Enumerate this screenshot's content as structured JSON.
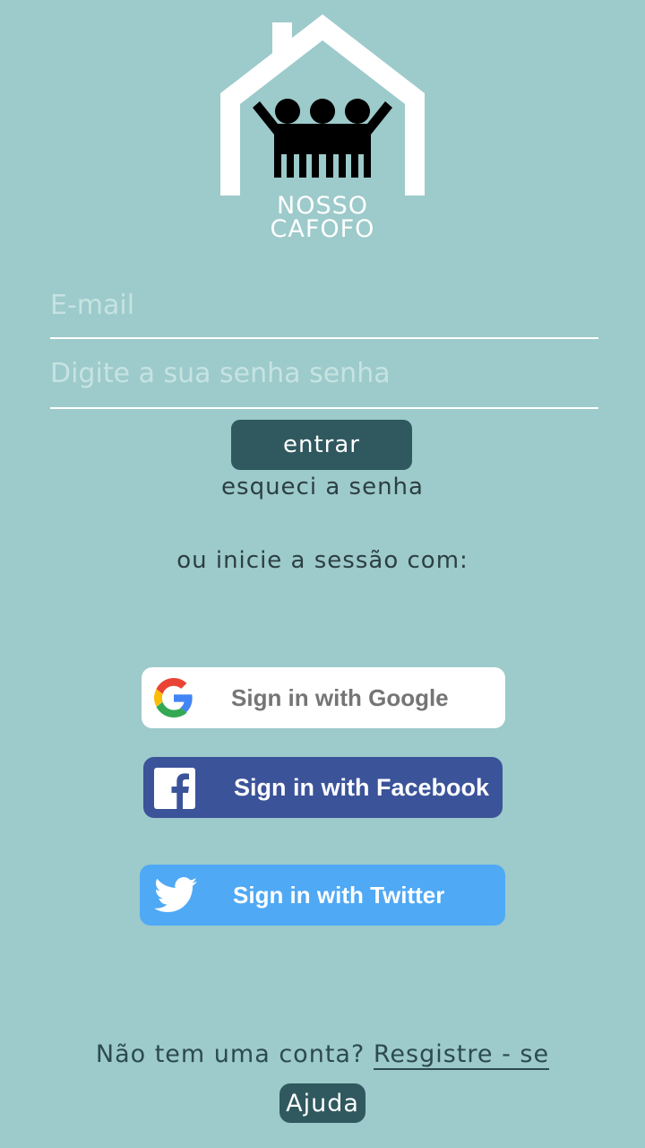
{
  "logo": {
    "line1": "NOSSO",
    "line2": "CAFOFO"
  },
  "login": {
    "email_placeholder": "E-mail",
    "password_placeholder": "Digite a sua senha senha",
    "submit_label": "entrar",
    "forgot_label": "esqueci a senha"
  },
  "social": {
    "intro": "ou inicie a sessão com:",
    "google_label": "Sign in with Google",
    "facebook_label": "Sign in with Facebook",
    "twitter_label": "Sign in with Twitter"
  },
  "footer": {
    "prompt": "Não tem uma conta?",
    "register_label": "Resgistre - se",
    "help_label": "Ajuda"
  },
  "colors": {
    "background": "#9dcacb",
    "button_dark": "#30595f",
    "facebook": "#3b5399",
    "twitter": "#4fa9f5",
    "google": "#ffffff"
  },
  "icons": {
    "logo": "house-family-logo",
    "google": "google-g-icon",
    "facebook": "facebook-f-icon",
    "twitter": "twitter-bird-icon"
  }
}
